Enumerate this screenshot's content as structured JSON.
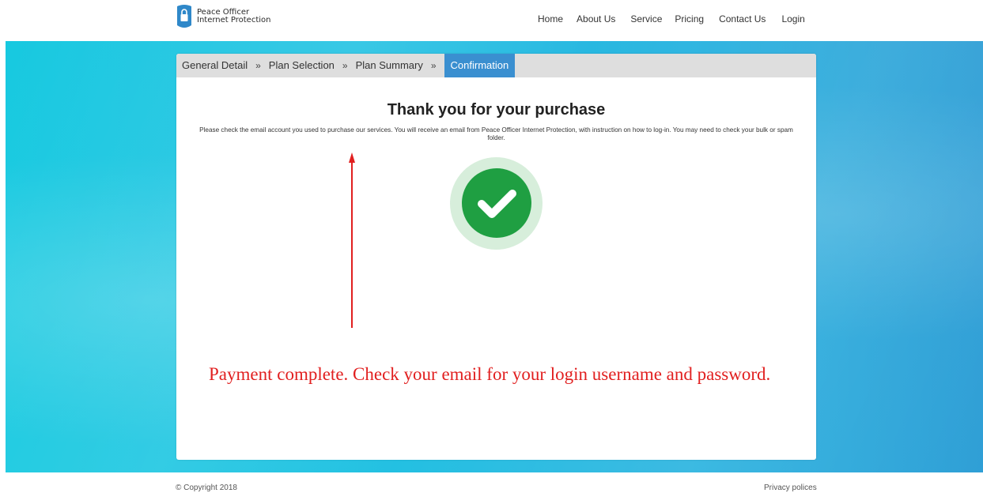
{
  "header": {
    "logo_line1": "Peace Officer",
    "logo_line2": "Internet Protection",
    "nav": [
      "Home",
      "About Us",
      "Service",
      "Pricing",
      "Contact Us",
      "Login"
    ]
  },
  "steps": {
    "items": [
      "General Detail",
      "Plan Selection",
      "Plan Summary",
      "Confirmation"
    ],
    "separator": "»",
    "active": "Confirmation"
  },
  "main": {
    "title": "Thank you for your purchase",
    "description": "Please check the email account you used to purchase our services. You will receive an email from Peace Officer Internet Protection, with instruction on how to log-in. You may need to check your bulk or spam folder.",
    "status_icon": "check-circle-icon"
  },
  "annotation": {
    "text": "Payment complete.  Check your email for your login username and password.",
    "color": "#e11f1f"
  },
  "footer": {
    "copyright": "© Copyright 2018",
    "privacy": "Privacy polices"
  },
  "colors": {
    "accent": "#3a8fd0",
    "success": "#1f9f42",
    "hero": "#1fc6e0"
  }
}
